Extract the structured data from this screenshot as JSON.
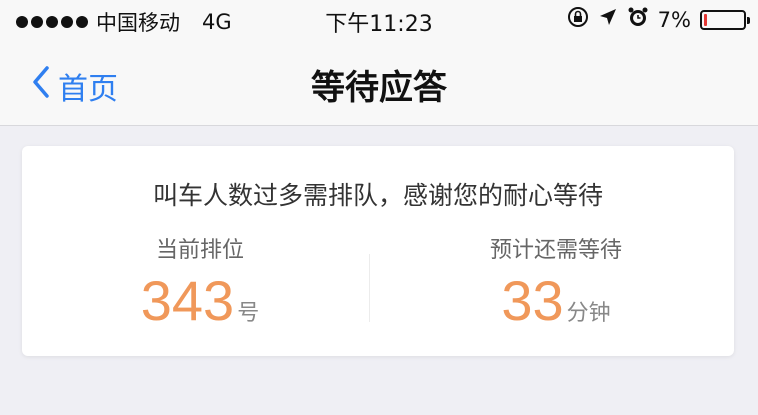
{
  "status_bar": {
    "carrier": "中国移动",
    "network": "4G",
    "time": "下午11:23",
    "battery_percent": "7%",
    "battery_level": 0.07,
    "colors": {
      "battery_low": "#e53935"
    }
  },
  "nav": {
    "back_label": "首页",
    "title": "等待应答",
    "accent": "#2f7ff0"
  },
  "queue": {
    "message": "叫车人数过多需排队，感谢您的耐心等待",
    "position_label": "当前排位",
    "position_value": "343",
    "position_unit": "号",
    "wait_label": "预计还需等待",
    "wait_value": "33",
    "wait_unit": "分钟",
    "value_color": "#f0985a"
  },
  "icons": [
    "signal-dots-icon",
    "orientation-lock-icon",
    "location-arrow-icon",
    "alarm-icon",
    "battery-icon",
    "chevron-left-icon"
  ]
}
